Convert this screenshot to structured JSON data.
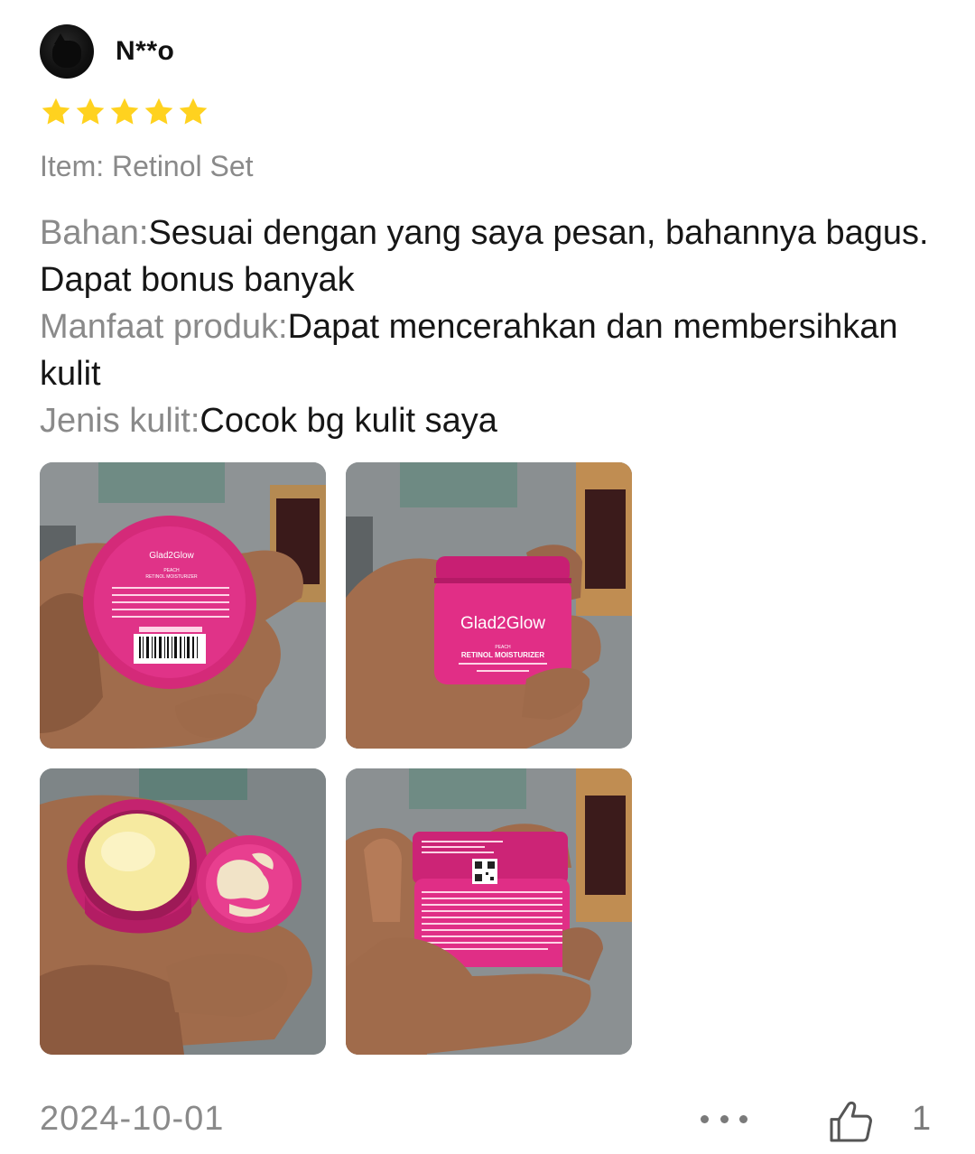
{
  "review": {
    "username": "N**o",
    "rating": 5,
    "item_label": "Item: Retinol Set",
    "fields": [
      {
        "key": "Bahan:",
        "value": "Sesuai dengan yang saya pesan, bahannya bagus. Dapat bonus banyak"
      },
      {
        "key": "Manfaat produk:",
        "value": "Dapat mencerahkan dan membersihkan kulit"
      },
      {
        "key": "Jenis kulit:",
        "value": "Cocok bg kulit saya"
      }
    ],
    "photos": [
      {
        "brand": "Glad2Glow",
        "variant": "PEACH",
        "product": "RETINOL MOISTURIZER"
      },
      {
        "brand": "Glad2Glow",
        "variant": "PEACH",
        "product": "RETINOL MOISTURIZER"
      },
      {
        "brand": "",
        "variant": "",
        "product": ""
      },
      {
        "brand": "",
        "variant": "",
        "product": ""
      }
    ],
    "date": "2024-10-01",
    "like_count": "1"
  },
  "colors": {
    "star": "#FFD21F",
    "muted_text": "#8A8A8A",
    "product_pink": "#E02685"
  },
  "icons": [
    "avatar",
    "star-icon",
    "more-icon",
    "thumbs-up-icon"
  ]
}
